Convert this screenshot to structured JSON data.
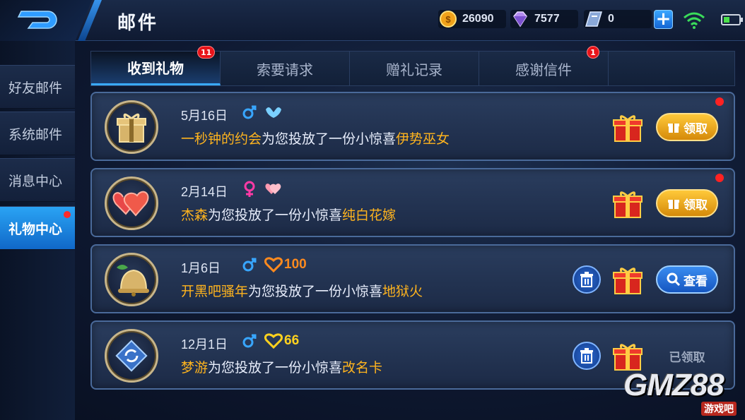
{
  "header": {
    "title": "邮件",
    "currencies": [
      {
        "name": "gold",
        "value": "26090"
      },
      {
        "name": "diamond",
        "value": "7577"
      },
      {
        "name": "coupon",
        "value": "0"
      }
    ],
    "add_label": "+"
  },
  "sidebar": {
    "items": [
      {
        "label": "好友邮件"
      },
      {
        "label": "系统邮件"
      },
      {
        "label": "消息中心"
      },
      {
        "label": "礼物中心",
        "active": true
      }
    ]
  },
  "tabs": [
    {
      "label": "收到礼物",
      "badge": "11",
      "active": true
    },
    {
      "label": "索要请求"
    },
    {
      "label": "赠礼记录"
    },
    {
      "label": "感谢信件",
      "badge": "1"
    }
  ],
  "gifts": [
    {
      "date": "5月16日",
      "sender": "一秒钟的约会",
      "middle": "为您投放了一份小惊喜",
      "item": "伊势巫女",
      "action": "领取",
      "icon": "gift-box-icon",
      "gender": "male"
    },
    {
      "date": "2月14日",
      "sender": "杰森",
      "middle": "为您投放了一份小惊喜",
      "item": "纯白花嫁",
      "action": "领取",
      "icon": "hearts-icon",
      "gender": "female"
    },
    {
      "date": "1月6日",
      "value": "100",
      "sender": "开黑吧骚年",
      "middle": "为您投放了一份小惊喜",
      "item": "地狱火",
      "action": "查看",
      "icon": "bell-icon",
      "gender": "male"
    },
    {
      "date": "12月1日",
      "value": "66",
      "sender": "梦游",
      "middle": "为您投放了一份小惊喜",
      "item": "改名卡",
      "action": "已领取",
      "icon": "rename-card-icon",
      "gender": "male"
    }
  ],
  "watermark": {
    "text": "GMZ88",
    "sub": "游戏吧"
  },
  "colors": {
    "accent": "#2aa4f4",
    "highlight": "#ffb41e",
    "badge": "#e8141a"
  }
}
